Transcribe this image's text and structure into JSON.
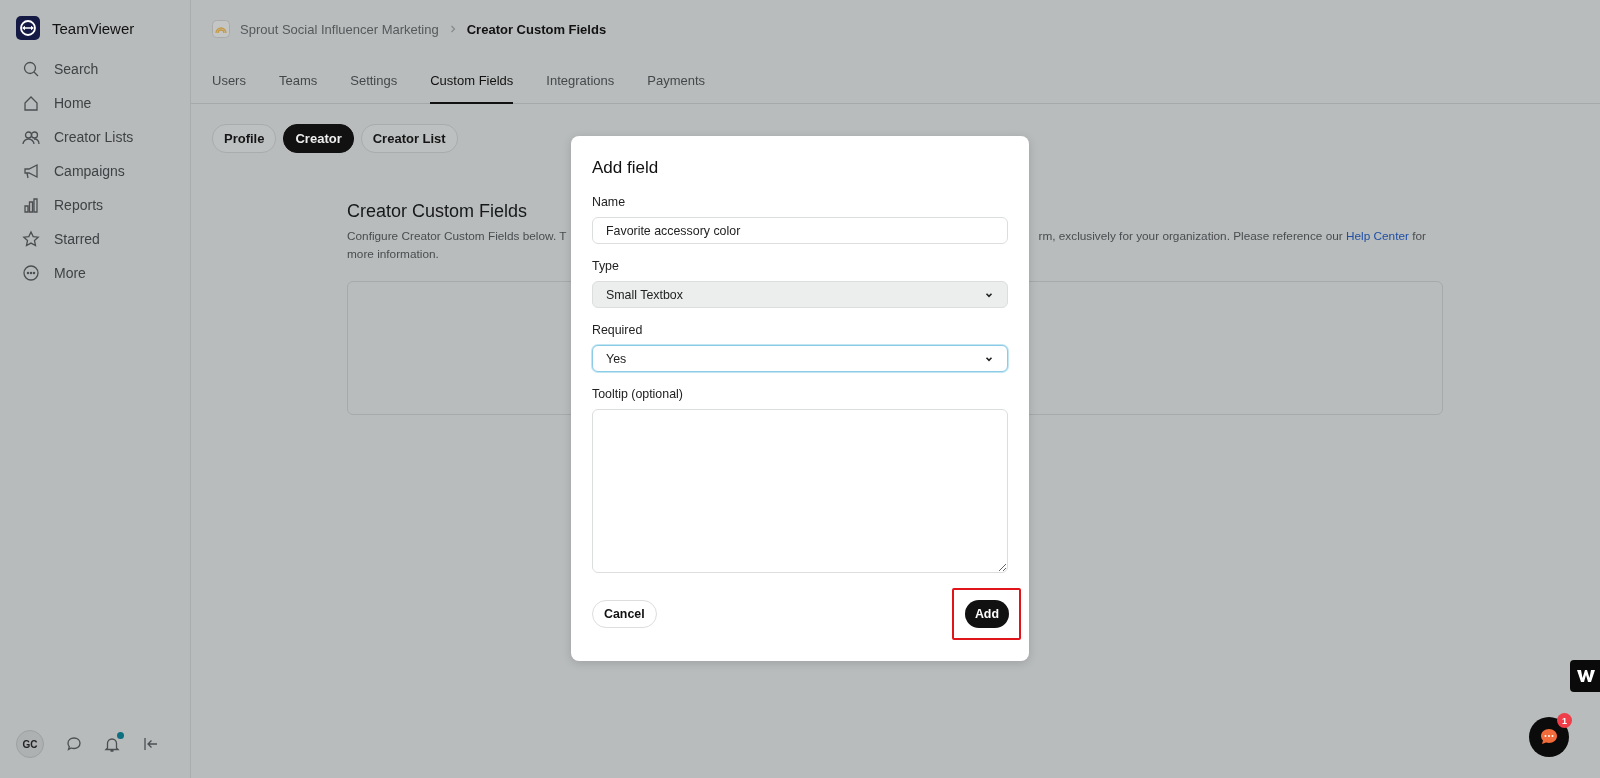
{
  "sidebar": {
    "brand": "TeamViewer",
    "items": [
      {
        "label": "Search"
      },
      {
        "label": "Home"
      },
      {
        "label": "Creator Lists"
      },
      {
        "label": "Campaigns"
      },
      {
        "label": "Reports"
      },
      {
        "label": "Starred"
      },
      {
        "label": "More"
      }
    ],
    "footer": {
      "avatar": "GC",
      "has_notification": true
    }
  },
  "breadcrumb": [
    "Sprout Social Influencer Marketing",
    "Creator Custom Fields"
  ],
  "tabs": [
    {
      "label": "Users",
      "selected": false
    },
    {
      "label": "Teams",
      "selected": false
    },
    {
      "label": "Settings",
      "selected": false
    },
    {
      "label": "Custom Fields",
      "selected": true
    },
    {
      "label": "Integrations",
      "selected": false
    },
    {
      "label": "Payments",
      "selected": false
    }
  ],
  "filters": [
    {
      "label": "Profile",
      "selected": false
    },
    {
      "label": "Creator",
      "selected": true
    },
    {
      "label": "Creator List",
      "selected": false
    }
  ],
  "section": {
    "title": "Creator Custom Fields",
    "description_left": "Configure Creator Custom Fields below. T",
    "description_right": "rm, exclusively for your organization. Please reference our",
    "link": "Help Center",
    "description_after_link": "for",
    "description_line2": "more information."
  },
  "dialog": {
    "title": "Add field",
    "fields": [
      {
        "kind": "text",
        "label": "Name",
        "value": "Favorite accessory color",
        "focused": false
      },
      {
        "kind": "select",
        "label": "Type",
        "value": "Small Textbox",
        "focused": false
      },
      {
        "kind": "select",
        "label": "Required",
        "value": "Yes",
        "focused": true
      },
      {
        "kind": "textarea",
        "label": "Tooltip (optional)",
        "focused": false
      }
    ],
    "cancel": "Cancel",
    "submit": "Add",
    "submit_highlighted": true
  },
  "chat": {
    "unread": "1"
  }
}
